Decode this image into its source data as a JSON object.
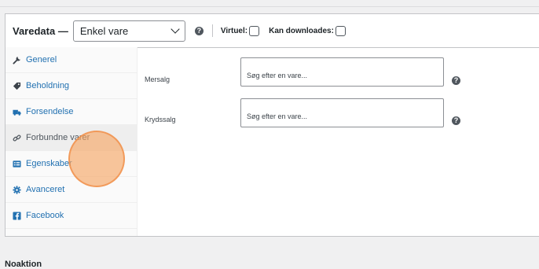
{
  "product_data": {
    "title": "Varedata —",
    "type_select": {
      "selected": "Enkel vare"
    },
    "virtual_label": "Virtuel:",
    "downloadable_label": "Kan downloades:",
    "help_glyph": "?"
  },
  "tabs": [
    {
      "label": "Generel",
      "icon": "wrench-icon"
    },
    {
      "label": "Beholdning",
      "icon": "tag-icon"
    },
    {
      "label": "Forsendelse",
      "icon": "truck-icon"
    },
    {
      "label": "Forbundne varer",
      "icon": "link-icon",
      "active": true
    },
    {
      "label": "Egenskaber",
      "icon": "list-icon"
    },
    {
      "label": "Avanceret",
      "icon": "gear-icon"
    },
    {
      "label": "Facebook",
      "icon": "facebook-icon"
    }
  ],
  "fields": {
    "upsell": {
      "label": "Mersalg",
      "placeholder": "Søg efter en vare..."
    },
    "crosssell": {
      "label": "Krydssalg",
      "placeholder": "Søg efter en vare..."
    }
  },
  "below": {
    "heading": "Noaktion"
  },
  "colors": {
    "link": "#2271b1",
    "highlight": "#f6a360",
    "border": "#c3c4c7"
  }
}
